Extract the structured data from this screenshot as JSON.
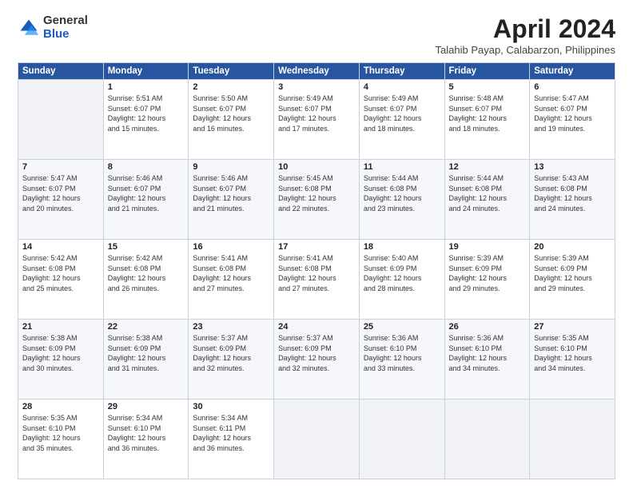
{
  "logo": {
    "general": "General",
    "blue": "Blue"
  },
  "title": {
    "month": "April 2024",
    "location": "Talahib Payap, Calabarzon, Philippines"
  },
  "weekdays": [
    "Sunday",
    "Monday",
    "Tuesday",
    "Wednesday",
    "Thursday",
    "Friday",
    "Saturday"
  ],
  "weeks": [
    [
      {
        "day": null,
        "info": null
      },
      {
        "day": "1",
        "info": "Sunrise: 5:51 AM\nSunset: 6:07 PM\nDaylight: 12 hours\nand 15 minutes."
      },
      {
        "day": "2",
        "info": "Sunrise: 5:50 AM\nSunset: 6:07 PM\nDaylight: 12 hours\nand 16 minutes."
      },
      {
        "day": "3",
        "info": "Sunrise: 5:49 AM\nSunset: 6:07 PM\nDaylight: 12 hours\nand 17 minutes."
      },
      {
        "day": "4",
        "info": "Sunrise: 5:49 AM\nSunset: 6:07 PM\nDaylight: 12 hours\nand 18 minutes."
      },
      {
        "day": "5",
        "info": "Sunrise: 5:48 AM\nSunset: 6:07 PM\nDaylight: 12 hours\nand 18 minutes."
      },
      {
        "day": "6",
        "info": "Sunrise: 5:47 AM\nSunset: 6:07 PM\nDaylight: 12 hours\nand 19 minutes."
      }
    ],
    [
      {
        "day": "7",
        "info": "Sunrise: 5:47 AM\nSunset: 6:07 PM\nDaylight: 12 hours\nand 20 minutes."
      },
      {
        "day": "8",
        "info": "Sunrise: 5:46 AM\nSunset: 6:07 PM\nDaylight: 12 hours\nand 21 minutes."
      },
      {
        "day": "9",
        "info": "Sunrise: 5:46 AM\nSunset: 6:07 PM\nDaylight: 12 hours\nand 21 minutes."
      },
      {
        "day": "10",
        "info": "Sunrise: 5:45 AM\nSunset: 6:08 PM\nDaylight: 12 hours\nand 22 minutes."
      },
      {
        "day": "11",
        "info": "Sunrise: 5:44 AM\nSunset: 6:08 PM\nDaylight: 12 hours\nand 23 minutes."
      },
      {
        "day": "12",
        "info": "Sunrise: 5:44 AM\nSunset: 6:08 PM\nDaylight: 12 hours\nand 24 minutes."
      },
      {
        "day": "13",
        "info": "Sunrise: 5:43 AM\nSunset: 6:08 PM\nDaylight: 12 hours\nand 24 minutes."
      }
    ],
    [
      {
        "day": "14",
        "info": "Sunrise: 5:42 AM\nSunset: 6:08 PM\nDaylight: 12 hours\nand 25 minutes."
      },
      {
        "day": "15",
        "info": "Sunrise: 5:42 AM\nSunset: 6:08 PM\nDaylight: 12 hours\nand 26 minutes."
      },
      {
        "day": "16",
        "info": "Sunrise: 5:41 AM\nSunset: 6:08 PM\nDaylight: 12 hours\nand 27 minutes."
      },
      {
        "day": "17",
        "info": "Sunrise: 5:41 AM\nSunset: 6:08 PM\nDaylight: 12 hours\nand 27 minutes."
      },
      {
        "day": "18",
        "info": "Sunrise: 5:40 AM\nSunset: 6:09 PM\nDaylight: 12 hours\nand 28 minutes."
      },
      {
        "day": "19",
        "info": "Sunrise: 5:39 AM\nSunset: 6:09 PM\nDaylight: 12 hours\nand 29 minutes."
      },
      {
        "day": "20",
        "info": "Sunrise: 5:39 AM\nSunset: 6:09 PM\nDaylight: 12 hours\nand 29 minutes."
      }
    ],
    [
      {
        "day": "21",
        "info": "Sunrise: 5:38 AM\nSunset: 6:09 PM\nDaylight: 12 hours\nand 30 minutes."
      },
      {
        "day": "22",
        "info": "Sunrise: 5:38 AM\nSunset: 6:09 PM\nDaylight: 12 hours\nand 31 minutes."
      },
      {
        "day": "23",
        "info": "Sunrise: 5:37 AM\nSunset: 6:09 PM\nDaylight: 12 hours\nand 32 minutes."
      },
      {
        "day": "24",
        "info": "Sunrise: 5:37 AM\nSunset: 6:09 PM\nDaylight: 12 hours\nand 32 minutes."
      },
      {
        "day": "25",
        "info": "Sunrise: 5:36 AM\nSunset: 6:10 PM\nDaylight: 12 hours\nand 33 minutes."
      },
      {
        "day": "26",
        "info": "Sunrise: 5:36 AM\nSunset: 6:10 PM\nDaylight: 12 hours\nand 34 minutes."
      },
      {
        "day": "27",
        "info": "Sunrise: 5:35 AM\nSunset: 6:10 PM\nDaylight: 12 hours\nand 34 minutes."
      }
    ],
    [
      {
        "day": "28",
        "info": "Sunrise: 5:35 AM\nSunset: 6:10 PM\nDaylight: 12 hours\nand 35 minutes."
      },
      {
        "day": "29",
        "info": "Sunrise: 5:34 AM\nSunset: 6:10 PM\nDaylight: 12 hours\nand 36 minutes."
      },
      {
        "day": "30",
        "info": "Sunrise: 5:34 AM\nSunset: 6:11 PM\nDaylight: 12 hours\nand 36 minutes."
      },
      {
        "day": null,
        "info": null
      },
      {
        "day": null,
        "info": null
      },
      {
        "day": null,
        "info": null
      },
      {
        "day": null,
        "info": null
      }
    ]
  ]
}
